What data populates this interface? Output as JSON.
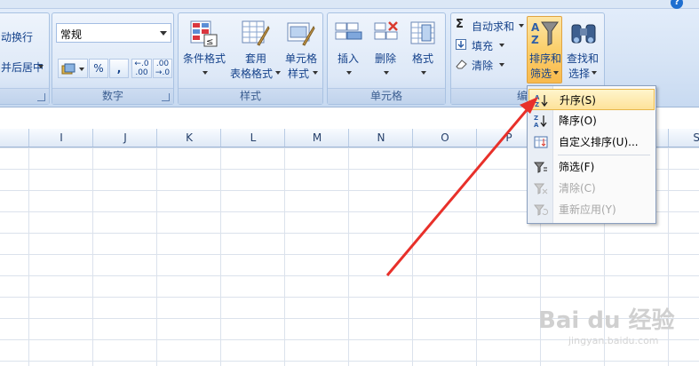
{
  "ribbon": {
    "wrap_fragment": "动换行",
    "merge_fragment": "并后居中",
    "number_format_value": "常规",
    "number_group_label": "数字",
    "percent_label": "%",
    "comma_label": ",",
    "inc_decimal_label": "←.0 .00",
    "dec_decimal_label": ".00 →.0",
    "styles": {
      "group_label": "样式",
      "conditional_label": "条件格式",
      "table_format_line1": "套用",
      "table_format_line2": "表格格式",
      "cell_style_line1": "单元格",
      "cell_style_line2": "样式"
    },
    "cells": {
      "group_label": "单元格",
      "insert_label": "插入",
      "delete_label": "删除",
      "format_label": "格式"
    },
    "editing": {
      "group_label_fragment": "编",
      "autosum_label": "自动求和",
      "fill_label": "填充",
      "clear_label": "清除",
      "sort_line1": "排序和",
      "sort_line2": "筛选",
      "find_line1": "查找和",
      "find_line2": "选择"
    }
  },
  "columns": [
    "I",
    "J",
    "K",
    "L",
    "M",
    "N",
    "O",
    "P",
    "S"
  ],
  "sort_menu": {
    "items": [
      {
        "label": "升序(S)",
        "highlighted": true,
        "disabled": false,
        "icon": "sort-ascending-icon"
      },
      {
        "label": "降序(O)",
        "highlighted": false,
        "disabled": false,
        "icon": "sort-descending-icon"
      },
      {
        "label": "自定义排序(U)...",
        "highlighted": false,
        "disabled": false,
        "icon": "custom-sort-icon"
      },
      {
        "label": "筛选(F)",
        "highlighted": false,
        "disabled": false,
        "icon": "filter-icon"
      },
      {
        "label": "清除(C)",
        "highlighted": false,
        "disabled": true,
        "icon": "clear-filter-icon"
      },
      {
        "label": "重新应用(Y)",
        "highlighted": false,
        "disabled": true,
        "icon": "reapply-icon"
      }
    ]
  },
  "watermark": {
    "text": "Bai du 经验",
    "url": "jingyan.baidu.com"
  },
  "colors": {
    "accent": "#15428b",
    "highlight": "#fbcf6b",
    "annotation_arrow": "#e8302a"
  }
}
